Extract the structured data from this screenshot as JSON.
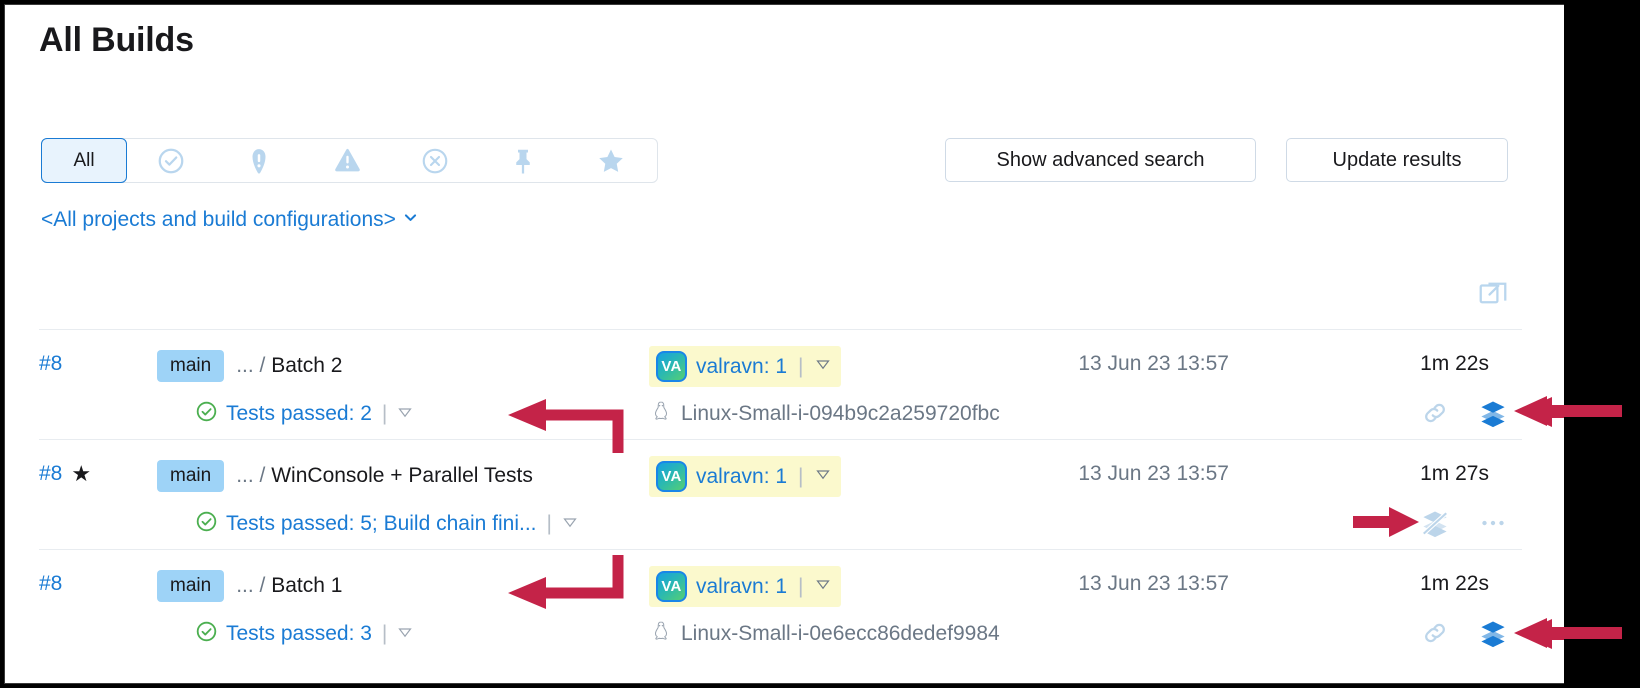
{
  "page": {
    "title": "All Builds"
  },
  "filters": {
    "all_label": "All",
    "icons": [
      {
        "name": "success-circle-icon"
      },
      {
        "name": "error-exclamation-icon"
      },
      {
        "name": "warning-triangle-icon"
      },
      {
        "name": "cancelled-circle-icon"
      },
      {
        "name": "pin-icon"
      },
      {
        "name": "star-icon"
      }
    ]
  },
  "project_selector": {
    "label": "<All projects and build configurations>",
    "caret": "chevron-down-icon"
  },
  "toolbar": {
    "advanced_search_label": "Show advanced search",
    "update_results_label": "Update results",
    "expand_icon": "open-in-new-window-icon"
  },
  "builds": [
    {
      "number": "#8",
      "starred": false,
      "branch": "main",
      "path_prefix": "...",
      "path_separator": "/",
      "name": "Batch 2",
      "status": "Tests passed: 2",
      "status_icon": "success-check-circle-icon",
      "agent_initials": "VA",
      "agent": "valravn: 1",
      "host": "Linux-Small-i-094b9c2a259720fbc",
      "host_icon": "linux-penguin-icon",
      "time": "13 Jun 23 13:57",
      "duration": "1m 22s",
      "icons": [
        "chain-link-icon",
        "build-chain-stack-icon"
      ]
    },
    {
      "number": "#8",
      "starred": true,
      "branch": "main",
      "path_prefix": "...",
      "path_separator": "/",
      "name": "WinConsole + Parallel Tests",
      "status": "Tests passed: 5; Build chain fini...",
      "status_icon": "success-check-circle-icon",
      "agent_initials": "VA",
      "agent": "valravn: 1",
      "host": "",
      "host_icon": "",
      "time": "13 Jun 23 13:57",
      "duration": "1m 27s",
      "icons": [
        "build-chain-stack-crossed-icon",
        "more-options-icon"
      ]
    },
    {
      "number": "#8",
      "starred": false,
      "branch": "main",
      "path_prefix": "...",
      "path_separator": "/",
      "name": "Batch 1",
      "status": "Tests passed: 3",
      "status_icon": "success-check-circle-icon",
      "agent_initials": "VA",
      "agent": "valravn: 1",
      "host": "Linux-Small-i-0e6ecc86dedef9984",
      "host_icon": "linux-penguin-icon",
      "time": "13 Jun 23 13:57",
      "duration": "1m 22s",
      "icons": [
        "chain-link-icon",
        "build-chain-stack-icon"
      ]
    }
  ],
  "annotations": {
    "color": "#c42348",
    "arrows": [
      {
        "name": "arrow-to-batch-2-row"
      },
      {
        "name": "arrow-to-batch-1-row"
      },
      {
        "name": "arrow-to-chain-icon-row2"
      },
      {
        "name": "arrow-to-stack-icon-row1"
      },
      {
        "name": "arrow-to-stack-icon-row3"
      }
    ]
  },
  "colors": {
    "link": "#1a7bd4",
    "branch_chip": "#9ed3f7",
    "agent_highlight": "#fbf9cd",
    "success": "#4caf50",
    "annotation": "#c42348"
  }
}
